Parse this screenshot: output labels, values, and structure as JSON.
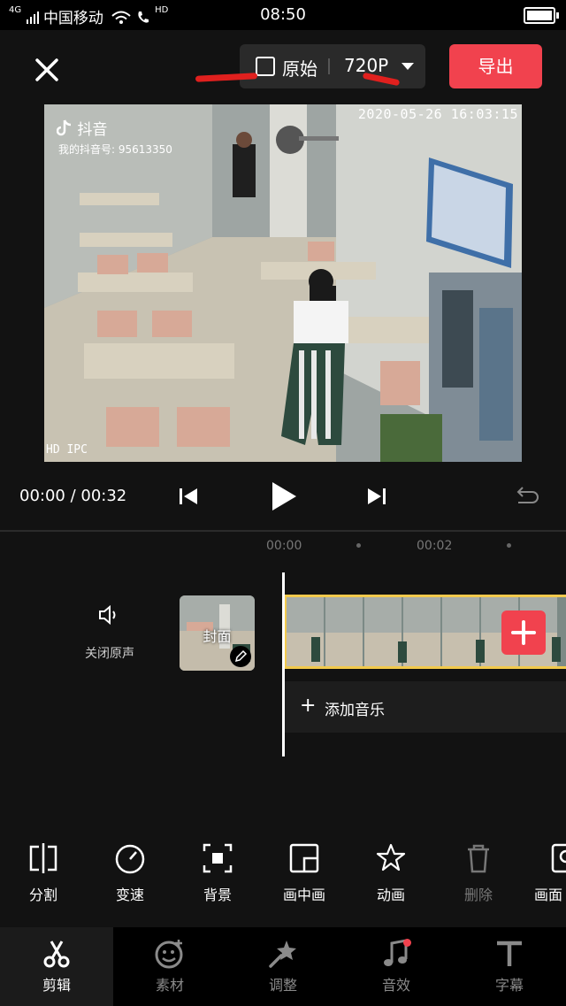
{
  "status_bar": {
    "carrier": "中国移动",
    "time": "08:50",
    "network": "4G",
    "hd_badge": "HD"
  },
  "header": {
    "ratio_label": "原始",
    "resolution_label": "720P",
    "export_label": "导出"
  },
  "preview": {
    "timestamp": "2020-05-26 16:03:15",
    "overlay_brand": "抖音",
    "overlay_id": "我的抖音号: 95613350",
    "camera_label": "HD IPC"
  },
  "playback": {
    "timecode": "00:00 / 00:32"
  },
  "ruler": {
    "ticks": [
      "00:00",
      "00:02"
    ]
  },
  "timeline": {
    "mute_label": "关闭原声",
    "cover_label": "封面",
    "add_music_label": "添加音乐"
  },
  "tools": [
    {
      "label": "分割",
      "icon": "split-icon"
    },
    {
      "label": "变速",
      "icon": "speed-icon"
    },
    {
      "label": "背景",
      "icon": "background-icon"
    },
    {
      "label": "画中画",
      "icon": "picture-in-picture-icon"
    },
    {
      "label": "动画",
      "icon": "animation-icon"
    },
    {
      "label": "删除",
      "icon": "delete-icon"
    },
    {
      "label": "画面",
      "icon": "frame-icon"
    }
  ],
  "bottom_nav": [
    {
      "label": "剪辑",
      "icon": "scissors-icon",
      "active": true
    },
    {
      "label": "素材",
      "icon": "sticker-icon",
      "active": false
    },
    {
      "label": "调整",
      "icon": "adjust-icon",
      "active": false
    },
    {
      "label": "音效",
      "icon": "music-note-icon",
      "active": false
    },
    {
      "label": "字幕",
      "icon": "text-icon",
      "active": false
    }
  ],
  "colors": {
    "accent_red": "#f1424e",
    "clip_border": "#f2c94c",
    "background": "#121212"
  }
}
